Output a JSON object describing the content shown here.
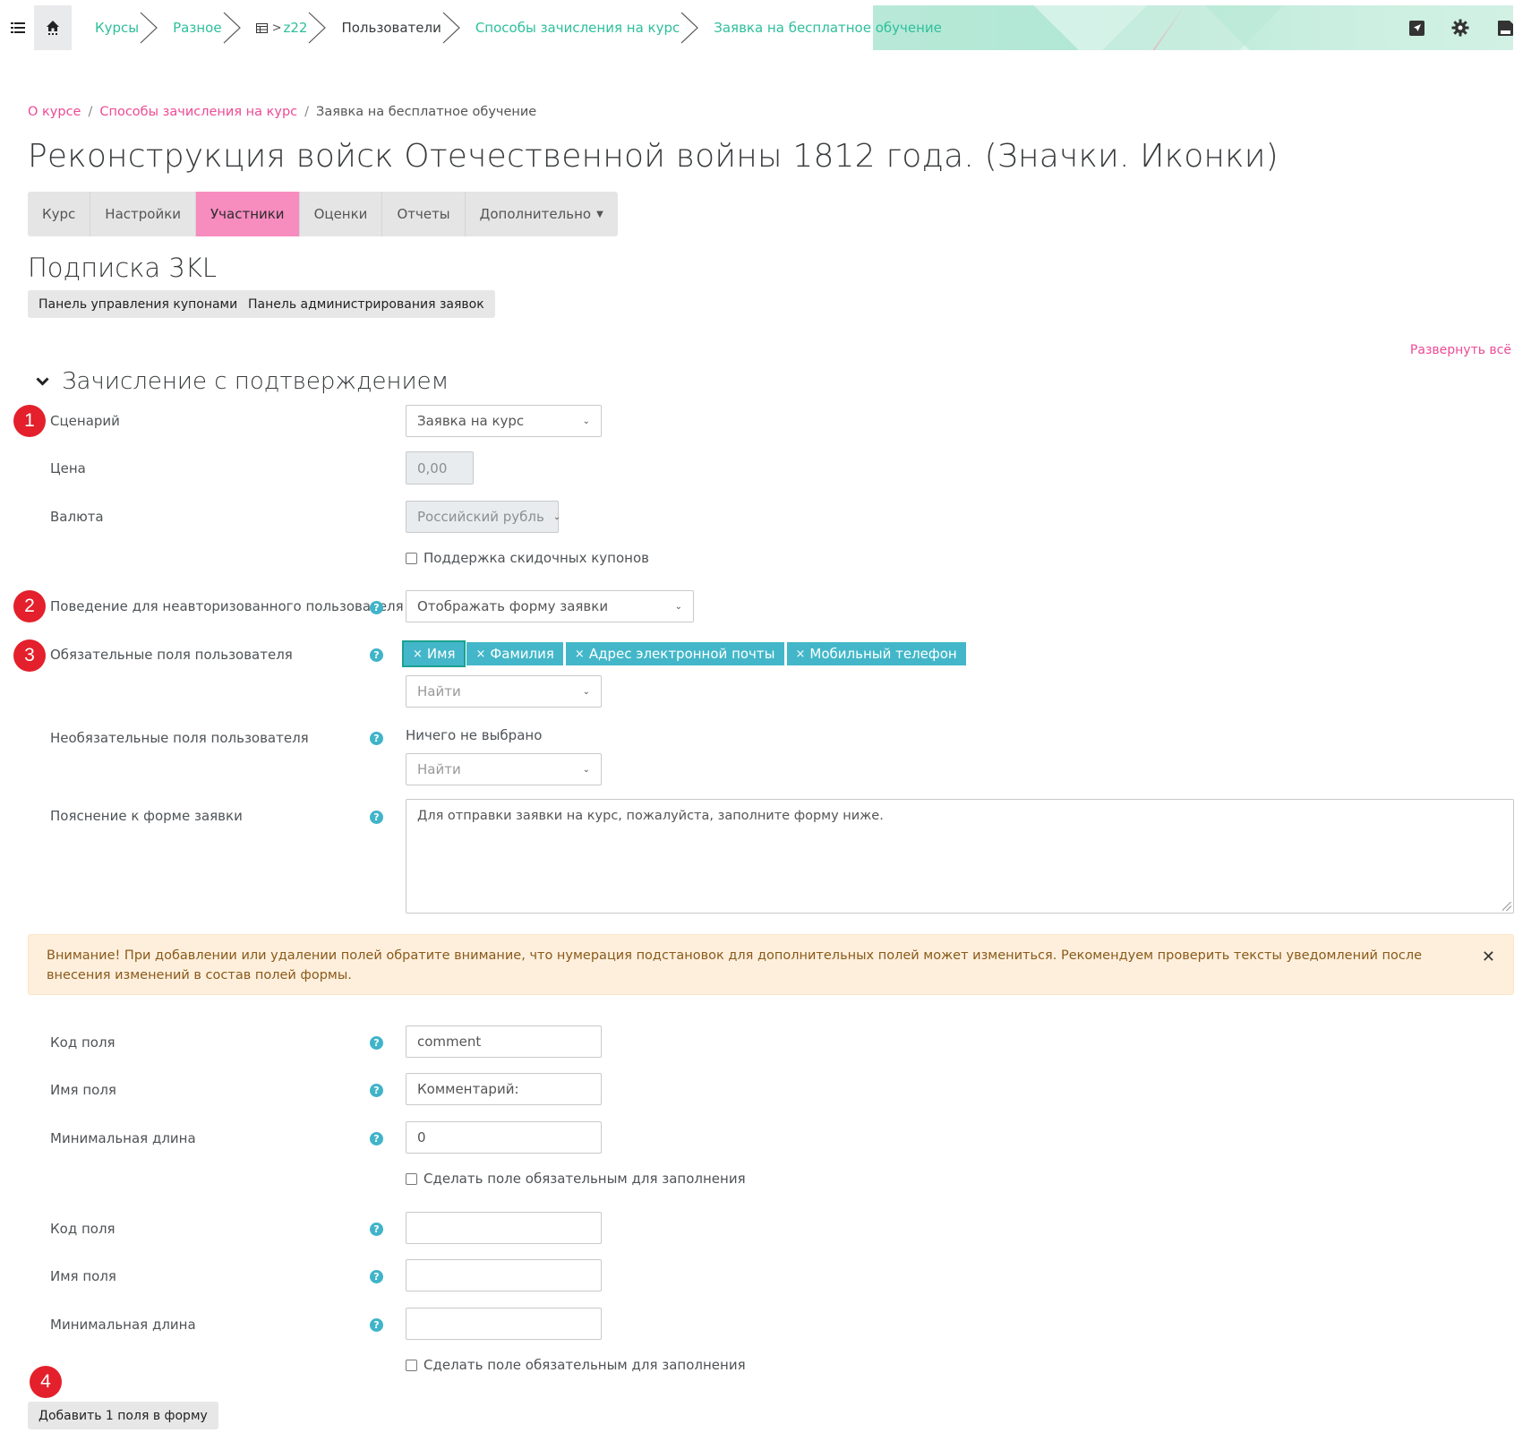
{
  "navbar": {
    "breadcrumb": [
      {
        "label": "Курсы",
        "link": true
      },
      {
        "label": "Разное",
        "link": true
      },
      {
        "label": "z22",
        "link": true,
        "icon": "table-icon"
      },
      {
        "label": "Пользователи",
        "link": false
      },
      {
        "label": "Способы зачисления на курс",
        "link": true
      },
      {
        "label": "Заявка на бесплатное обучение",
        "link": true
      }
    ],
    "icons": [
      "list-icon",
      "home-icon",
      "send-icon",
      "gear-icon",
      "save-icon"
    ]
  },
  "page": {
    "breadcrumb": {
      "item1": "О курсе",
      "item2": "Способы зачисления на курс",
      "current": "Заявка на бесплатное обучение",
      "sep": "/"
    },
    "title": "Реконструкция войск Отечественной войны 1812 года. (Значки. Иконки)"
  },
  "tabs": {
    "course": "Курс",
    "settings": "Настройки",
    "participants": "Участники",
    "grades": "Оценки",
    "reports": "Отчеты",
    "more": "Дополнительно"
  },
  "subscription": {
    "heading": "Подписка 3KL",
    "coupons_button": "Панель управления купонами",
    "requests_button": "Панель администрирования заявок"
  },
  "form": {
    "expand_all": "Развернуть всё",
    "section_title": "Зачисление с подтверждением",
    "scenario_label": "Сценарий",
    "scenario_value": "Заявка на курс",
    "price_label": "Цена",
    "price_value": "0,00",
    "currency_label": "Валюта",
    "currency_value": "Российский рубль",
    "coupons_checkbox": "Поддержка скидочных купонов",
    "guest_label": "Поведение для неавторизованного пользователя",
    "guest_value": "Отображать форму заявки",
    "required_label": "Обязательные поля пользователя",
    "required_tags": [
      "Имя",
      "Фамилия",
      "Адрес электронной почты",
      "Мобильный телефон"
    ],
    "search_placeholder": "Найти",
    "optional_label": "Необязательные поля пользователя",
    "optional_none": "Ничего не выбрано",
    "explanation_label": "Пояснение к форме заявки",
    "explanation_value": "Для отправки заявки на курс, пожалуйста, заполните форму ниже.",
    "alert_text": "Внимание! При добавлении или удалении полей обратите внимание, что нумерация подстановок для дополнительных полей может измениться. Рекомендуем проверить тексты уведомлений после внесения изменений в состав полей формы.",
    "field1": {
      "code_label": "Код поля",
      "code_value": "comment",
      "name_label": "Имя поля",
      "name_value": "Комментарий:",
      "minlen_label": "Минимальная длина",
      "minlen_value": "0",
      "required_checkbox": "Сделать поле обязательным для заполнения"
    },
    "field2": {
      "code_label": "Код поля",
      "code_value": "",
      "name_label": "Имя поля",
      "name_value": "",
      "minlen_label": "Минимальная длина",
      "minlen_value": "",
      "required_checkbox": "Сделать поле обязательным для заполнения"
    },
    "add_button": "Добавить 1 поля в форму"
  },
  "markers": [
    "1",
    "2",
    "3",
    "4"
  ],
  "colors": {
    "accent_teal": "#2dbf9c",
    "link_pink": "#ed4b95",
    "active_tab": "#f78cbf",
    "tag_blue": "#43b7c9",
    "marker_red": "#e3202b",
    "alert_bg": "#fdefdc"
  }
}
